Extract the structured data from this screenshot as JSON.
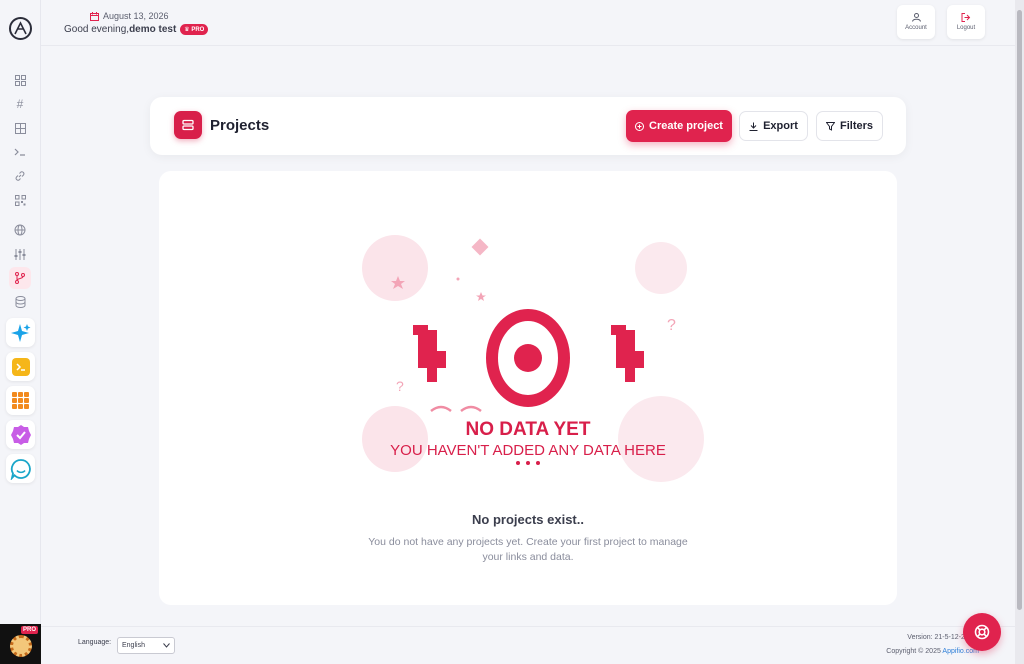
{
  "header": {
    "date": "August 13, 2026",
    "greeting_prefix": "Good evening,",
    "user_name": "demo test",
    "plan_badge": "PRO",
    "account_label": "Account",
    "logout_label": "Logout"
  },
  "sidebar": {
    "items": [
      {
        "name": "dashboard",
        "icon": "grid-icon"
      },
      {
        "name": "hash",
        "icon": "hash-icon"
      },
      {
        "name": "table",
        "icon": "table-icon"
      },
      {
        "name": "terminal",
        "icon": "terminal-icon"
      },
      {
        "name": "links",
        "icon": "link-icon"
      },
      {
        "name": "qr",
        "icon": "qr-icon"
      },
      {
        "name": "globe",
        "icon": "globe-icon"
      },
      {
        "name": "sliders",
        "icon": "sliders-icon"
      },
      {
        "name": "projects",
        "icon": "branch-icon",
        "active": true
      },
      {
        "name": "database",
        "icon": "database-icon"
      }
    ],
    "apps": [
      "sparkle-app-icon",
      "terminal-app-icon",
      "apps-grid-icon",
      "verified-app-icon",
      "chat-app-icon"
    ],
    "user_badge": "PRO"
  },
  "toolbar": {
    "title": "Projects",
    "create_label": "Create project",
    "export_label": "Export",
    "filters_label": "Filters"
  },
  "empty_state": {
    "illustration_line1": "NO DATA YET",
    "illustration_line2": "YOU HAVEN'T ADDED ANY DATA HERE",
    "illustration_code": "404",
    "title": "No projects exist..",
    "description": "You do not have any projects yet. Create your first project to manage your links and data."
  },
  "footer": {
    "language_label": "Language:",
    "language_value": "English",
    "version": "Version: 21-5-12-25-a",
    "copyright_prefix": "Copyright © 2025",
    "copyright_link": "Appifio.com"
  },
  "colors": {
    "accent": "#e0234e",
    "background": "#f4f5f9",
    "card": "#ffffff"
  }
}
